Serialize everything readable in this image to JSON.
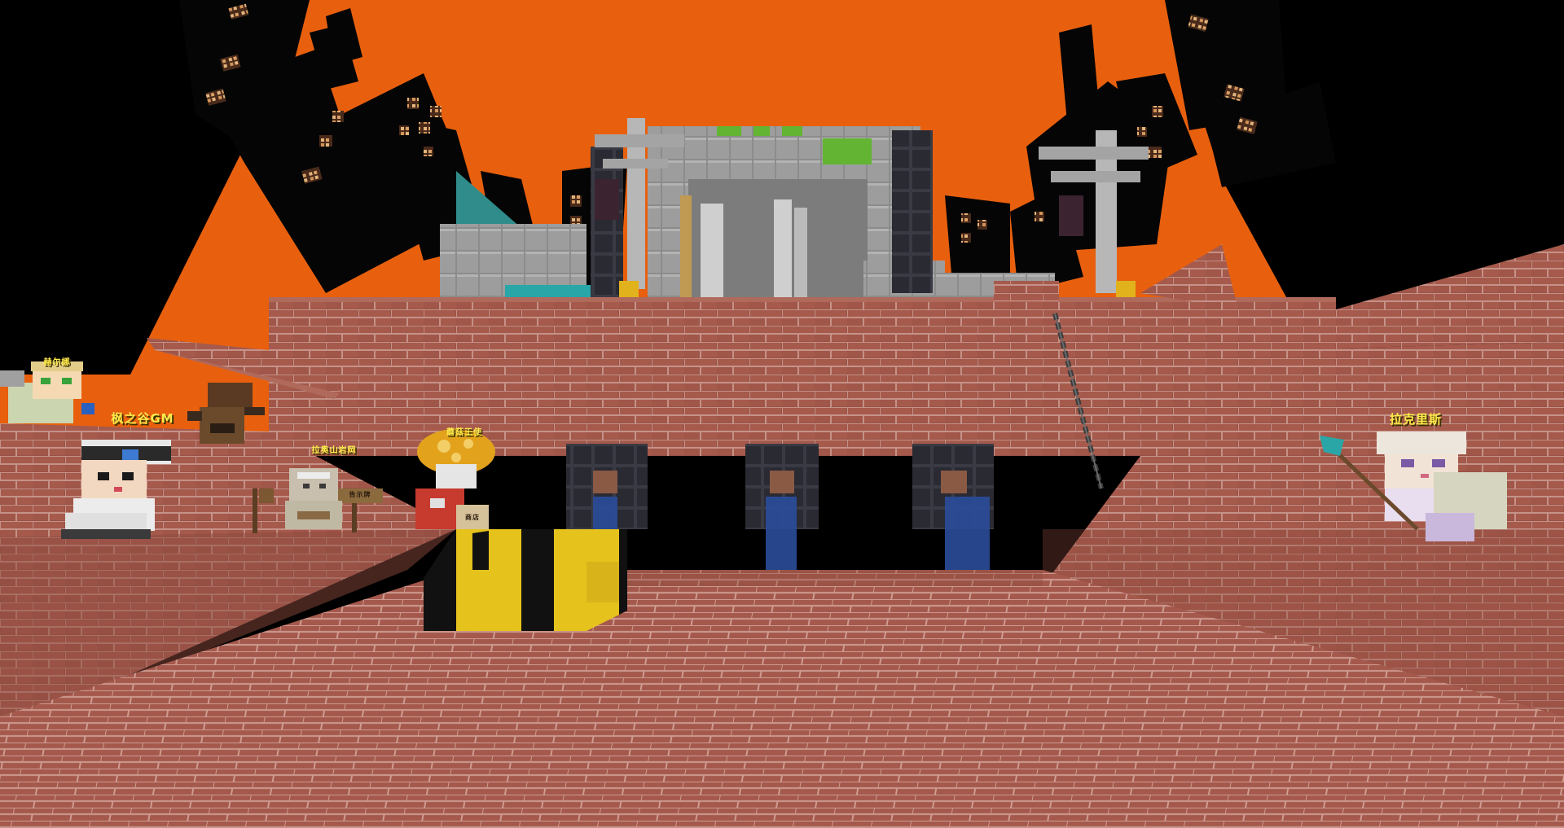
{
  "scene": {
    "name": "blocky factory courtyard at sunset",
    "sky_color": "#e8600e",
    "brick_color": "#9e5548",
    "mortar_color": "#c49088"
  },
  "npcs": [
    {
      "id": "npc-1",
      "name": "赫尔娜",
      "tag_size": "small"
    },
    {
      "id": "npc-2",
      "name": "枫之谷GM",
      "tag_size": "large"
    },
    {
      "id": "npc-3",
      "name": "拉奥山岩岡",
      "tag_size": "small"
    },
    {
      "id": "npc-4",
      "name": "蘑菇王使",
      "tag_size": "small"
    },
    {
      "id": "npc-5",
      "name": "拉克里斯",
      "tag_size": "large"
    }
  ],
  "signs": [
    {
      "id": "sign-1",
      "text": "告示牌"
    },
    {
      "id": "sign-2",
      "text": "商店"
    }
  ]
}
